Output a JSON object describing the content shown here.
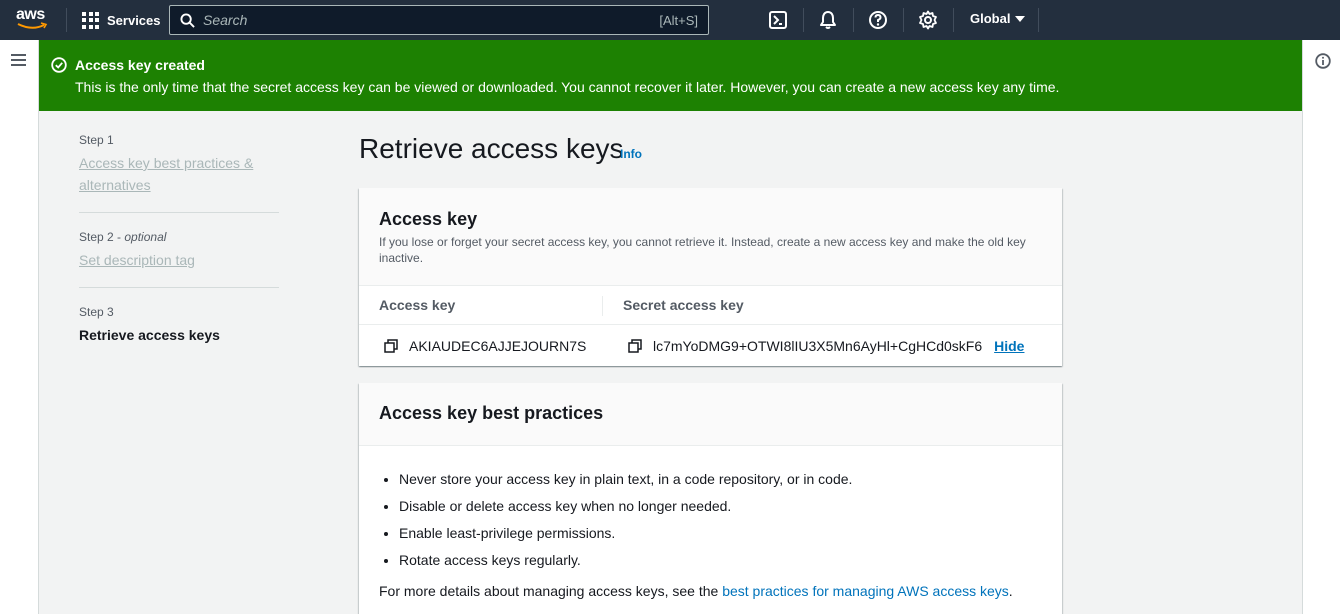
{
  "nav": {
    "logo_text": "aws",
    "services_label": "Services",
    "search_placeholder": "Search",
    "search_shortcut": "[Alt+S]",
    "region_label": "Global",
    "icons": [
      "cloudshell-icon",
      "bell-icon",
      "help-icon",
      "gear-icon"
    ]
  },
  "flash": {
    "title": "Access key created",
    "message": "This is the only time that the secret access key can be viewed or downloaded. You cannot recover it later. However, you can create a new access key any time.",
    "color": "#1d8102"
  },
  "steps": [
    {
      "label": "Step 1",
      "optional": "",
      "title": "Access key best practices & alternatives",
      "state": "link"
    },
    {
      "label": "Step 2",
      "optional": "optional",
      "title": "Set description tag",
      "state": "link"
    },
    {
      "label": "Step 3",
      "optional": "",
      "title": "Retrieve access keys",
      "state": "current"
    }
  ],
  "step2_sep": " - ",
  "main": {
    "title": "Retrieve access keys",
    "info_label": "Info"
  },
  "access_key_card": {
    "title": "Access key",
    "description": "If you lose or forget your secret access key, you cannot retrieve it. Instead, create a new access key and make the old key inactive.",
    "columns": [
      "Access key",
      "Secret access key"
    ],
    "access_key": "AKIAUDEC6AJJEJOURN7S",
    "secret_key": "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",
    "hide_label": "Hide"
  },
  "best_practices": {
    "title": "Access key best practices",
    "items": [
      "Never store your access key in plain text, in a code repository, or in code.",
      "Disable or delete access key when no longer needed.",
      "Enable least-privilege permissions.",
      "Rotate access keys regularly."
    ],
    "more_prefix": "For more details about managing access keys, see the ",
    "more_link": "best practices for managing AWS access keys",
    "more_suffix": "."
  },
  "colors": {
    "nav_bg": "#232f3e",
    "link": "#0073bb",
    "success": "#1d8102"
  }
}
